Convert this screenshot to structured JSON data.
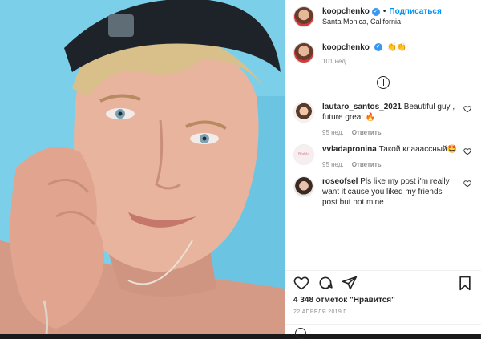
{
  "post": {
    "author": {
      "username": "koopchenko",
      "verified_icon": "verified-badge-icon",
      "follow_label": "Подписаться",
      "location": "Santa Monica, California"
    },
    "caption": {
      "username": "koopchenko",
      "text": "👏👏",
      "time": "101 нед."
    },
    "load_more_icon": "plus-circle-icon",
    "comments": [
      {
        "username": "lautaro_santos_2021",
        "text": "Beautiful guy , future great 🔥",
        "time": "95 нед.",
        "reply_label": "Ответить"
      },
      {
        "username": "vvladapronina",
        "text": "Такой клааассный🤩",
        "time": "95 нед.",
        "reply_label": "Ответить",
        "avatar_text": "Blabla"
      },
      {
        "username": "roseofsel",
        "text": "Pls like my post i'm really want it cause you liked my friends post but not mine",
        "time": "",
        "reply_label": ""
      }
    ],
    "actions": {
      "like_icon": "heart-icon",
      "comment_icon": "comment-icon",
      "share_icon": "paper-plane-icon",
      "save_icon": "bookmark-icon"
    },
    "likes_text": "4 348 отметок \"Нравится\"",
    "date": "22 АПРЕЛЯ 2019 Г."
  },
  "colors": {
    "accent": "#0095f6",
    "verified": "#3897f0",
    "muted": "#8e8e8e",
    "text": "#262626"
  }
}
